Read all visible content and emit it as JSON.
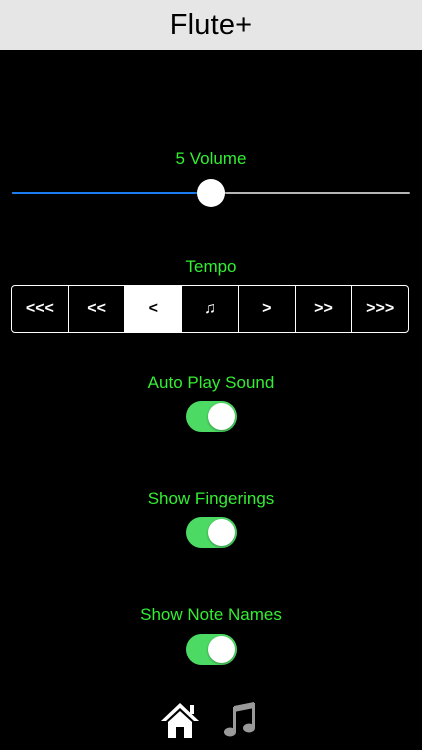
{
  "nav": {
    "title": "Flute+"
  },
  "volume": {
    "label": "5 Volume",
    "value_fraction": 0.5
  },
  "tempo": {
    "label": "Tempo",
    "segments": [
      "<<<",
      "<<",
      "<",
      "♫",
      ">",
      ">>",
      ">>>"
    ],
    "selected_index": 2
  },
  "toggles": {
    "auto_play": {
      "label": "Auto Play Sound",
      "on": true
    },
    "fingerings": {
      "label": "Show Fingerings",
      "on": true
    },
    "note_names": {
      "label": "Show Note Names",
      "on": true
    }
  },
  "tabbar": {
    "items": [
      {
        "icon": "home-icon",
        "selected": true
      },
      {
        "icon": "music-note-icon",
        "selected": false
      }
    ]
  },
  "colors": {
    "label_green": "#33ee33",
    "toggle_on": "#4cd964",
    "slider_fill": "#1a7cf0",
    "nav_background": "#e6e6e6",
    "background": "#000000"
  }
}
